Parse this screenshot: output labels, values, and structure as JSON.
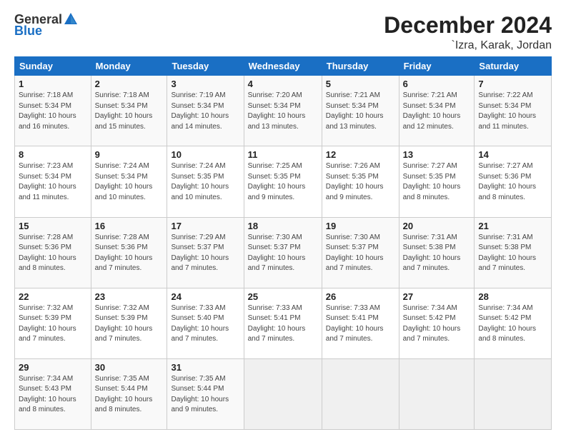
{
  "header": {
    "logo_general": "General",
    "logo_blue": "Blue",
    "month_title": "December 2024",
    "location": "`Izra, Karak, Jordan"
  },
  "days_of_week": [
    "Sunday",
    "Monday",
    "Tuesday",
    "Wednesday",
    "Thursday",
    "Friday",
    "Saturday"
  ],
  "weeks": [
    [
      {
        "day": "1",
        "info": "Sunrise: 7:18 AM\nSunset: 5:34 PM\nDaylight: 10 hours\nand 16 minutes."
      },
      {
        "day": "2",
        "info": "Sunrise: 7:18 AM\nSunset: 5:34 PM\nDaylight: 10 hours\nand 15 minutes."
      },
      {
        "day": "3",
        "info": "Sunrise: 7:19 AM\nSunset: 5:34 PM\nDaylight: 10 hours\nand 14 minutes."
      },
      {
        "day": "4",
        "info": "Sunrise: 7:20 AM\nSunset: 5:34 PM\nDaylight: 10 hours\nand 13 minutes."
      },
      {
        "day": "5",
        "info": "Sunrise: 7:21 AM\nSunset: 5:34 PM\nDaylight: 10 hours\nand 13 minutes."
      },
      {
        "day": "6",
        "info": "Sunrise: 7:21 AM\nSunset: 5:34 PM\nDaylight: 10 hours\nand 12 minutes."
      },
      {
        "day": "7",
        "info": "Sunrise: 7:22 AM\nSunset: 5:34 PM\nDaylight: 10 hours\nand 11 minutes."
      }
    ],
    [
      {
        "day": "8",
        "info": "Sunrise: 7:23 AM\nSunset: 5:34 PM\nDaylight: 10 hours\nand 11 minutes."
      },
      {
        "day": "9",
        "info": "Sunrise: 7:24 AM\nSunset: 5:34 PM\nDaylight: 10 hours\nand 10 minutes."
      },
      {
        "day": "10",
        "info": "Sunrise: 7:24 AM\nSunset: 5:35 PM\nDaylight: 10 hours\nand 10 minutes."
      },
      {
        "day": "11",
        "info": "Sunrise: 7:25 AM\nSunset: 5:35 PM\nDaylight: 10 hours\nand 9 minutes."
      },
      {
        "day": "12",
        "info": "Sunrise: 7:26 AM\nSunset: 5:35 PM\nDaylight: 10 hours\nand 9 minutes."
      },
      {
        "day": "13",
        "info": "Sunrise: 7:27 AM\nSunset: 5:35 PM\nDaylight: 10 hours\nand 8 minutes."
      },
      {
        "day": "14",
        "info": "Sunrise: 7:27 AM\nSunset: 5:36 PM\nDaylight: 10 hours\nand 8 minutes."
      }
    ],
    [
      {
        "day": "15",
        "info": "Sunrise: 7:28 AM\nSunset: 5:36 PM\nDaylight: 10 hours\nand 8 minutes."
      },
      {
        "day": "16",
        "info": "Sunrise: 7:28 AM\nSunset: 5:36 PM\nDaylight: 10 hours\nand 7 minutes."
      },
      {
        "day": "17",
        "info": "Sunrise: 7:29 AM\nSunset: 5:37 PM\nDaylight: 10 hours\nand 7 minutes."
      },
      {
        "day": "18",
        "info": "Sunrise: 7:30 AM\nSunset: 5:37 PM\nDaylight: 10 hours\nand 7 minutes."
      },
      {
        "day": "19",
        "info": "Sunrise: 7:30 AM\nSunset: 5:37 PM\nDaylight: 10 hours\nand 7 minutes."
      },
      {
        "day": "20",
        "info": "Sunrise: 7:31 AM\nSunset: 5:38 PM\nDaylight: 10 hours\nand 7 minutes."
      },
      {
        "day": "21",
        "info": "Sunrise: 7:31 AM\nSunset: 5:38 PM\nDaylight: 10 hours\nand 7 minutes."
      }
    ],
    [
      {
        "day": "22",
        "info": "Sunrise: 7:32 AM\nSunset: 5:39 PM\nDaylight: 10 hours\nand 7 minutes."
      },
      {
        "day": "23",
        "info": "Sunrise: 7:32 AM\nSunset: 5:39 PM\nDaylight: 10 hours\nand 7 minutes."
      },
      {
        "day": "24",
        "info": "Sunrise: 7:33 AM\nSunset: 5:40 PM\nDaylight: 10 hours\nand 7 minutes."
      },
      {
        "day": "25",
        "info": "Sunrise: 7:33 AM\nSunset: 5:41 PM\nDaylight: 10 hours\nand 7 minutes."
      },
      {
        "day": "26",
        "info": "Sunrise: 7:33 AM\nSunset: 5:41 PM\nDaylight: 10 hours\nand 7 minutes."
      },
      {
        "day": "27",
        "info": "Sunrise: 7:34 AM\nSunset: 5:42 PM\nDaylight: 10 hours\nand 7 minutes."
      },
      {
        "day": "28",
        "info": "Sunrise: 7:34 AM\nSunset: 5:42 PM\nDaylight: 10 hours\nand 8 minutes."
      }
    ],
    [
      {
        "day": "29",
        "info": "Sunrise: 7:34 AM\nSunset: 5:43 PM\nDaylight: 10 hours\nand 8 minutes."
      },
      {
        "day": "30",
        "info": "Sunrise: 7:35 AM\nSunset: 5:44 PM\nDaylight: 10 hours\nand 8 minutes."
      },
      {
        "day": "31",
        "info": "Sunrise: 7:35 AM\nSunset: 5:44 PM\nDaylight: 10 hours\nand 9 minutes."
      },
      {
        "day": "",
        "info": ""
      },
      {
        "day": "",
        "info": ""
      },
      {
        "day": "",
        "info": ""
      },
      {
        "day": "",
        "info": ""
      }
    ]
  ]
}
